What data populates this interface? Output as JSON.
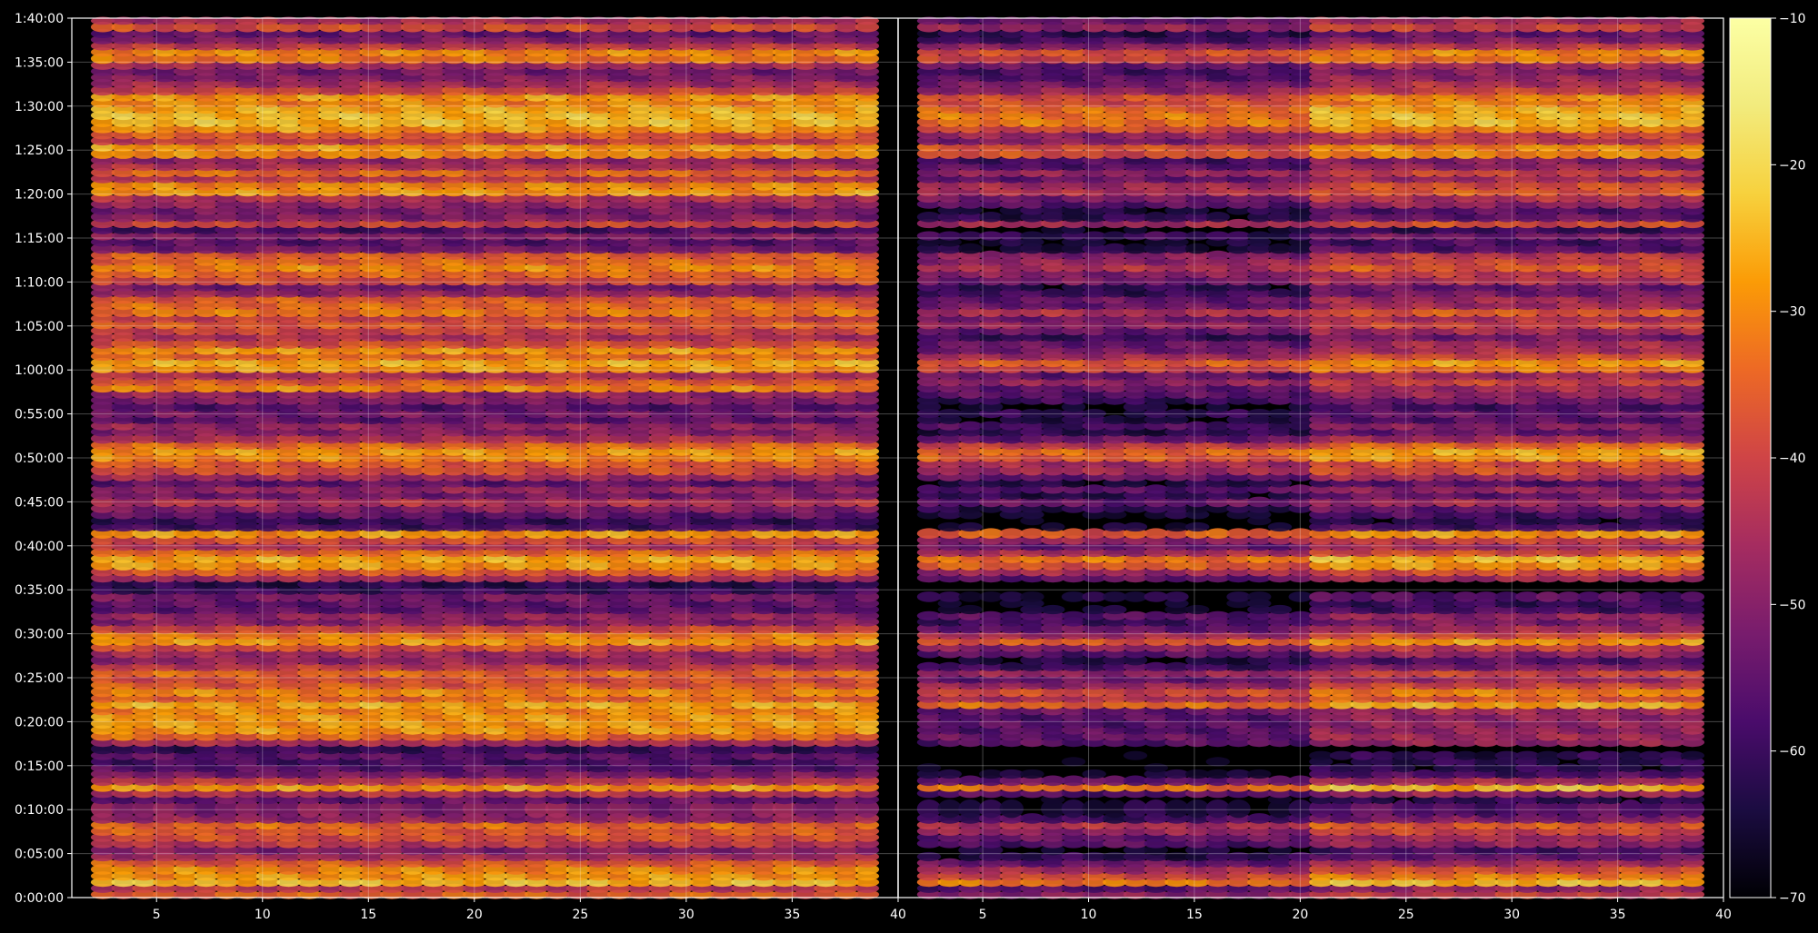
{
  "chart_data": {
    "type": "heatmap",
    "title": "",
    "xlabel": "",
    "ylabel": "",
    "panels": [
      {
        "name": "",
        "x_range": [
          1,
          40
        ]
      },
      {
        "name": "",
        "x_range": [
          40,
          80
        ]
      }
    ],
    "x_tick_labels": [
      "5",
      "10",
      "15",
      "20",
      "25",
      "30",
      "35",
      "40",
      "5",
      "10",
      "15",
      "20",
      "25",
      "30",
      "35",
      "40"
    ],
    "y_range_seconds": [
      0,
      6000
    ],
    "y_tick_labels": [
      "0:00:00",
      "0:05:00",
      "0:10:00",
      "0:15:00",
      "0:20:00",
      "0:25:00",
      "0:30:00",
      "0:35:00",
      "0:40:00",
      "0:45:00",
      "0:50:00",
      "0:55:00",
      "1:00:00",
      "1:05:00",
      "1:10:00",
      "1:15:00",
      "1:20:00",
      "1:25:00",
      "1:30:00",
      "1:35:00",
      "1:40:00"
    ],
    "colorbar": {
      "colormap": "inferno",
      "range": [
        -70,
        -10
      ],
      "tick_labels": [
        "−10",
        "−20",
        "−30",
        "−40",
        "−50",
        "−60",
        "−70"
      ]
    },
    "grid": true,
    "band_levels_description": "approximate level (dB) per horizontal band: [time_min, level_left_panel, level_right_panel]",
    "bands": [
      [
        0.0,
        -35,
        -45
      ],
      [
        0.7,
        -42,
        -52
      ],
      [
        1.4,
        -24,
        -28
      ],
      [
        2.1,
        -28,
        -35
      ],
      [
        2.8,
        -30,
        -42
      ],
      [
        3.6,
        -36,
        -50
      ],
      [
        4.3,
        -45,
        -58
      ],
      [
        5.0,
        -50,
        -62
      ],
      [
        5.8,
        -42,
        -52
      ],
      [
        6.5,
        -38,
        -50
      ],
      [
        7.2,
        -36,
        -44
      ],
      [
        7.9,
        -34,
        -40
      ],
      [
        8.6,
        -48,
        -55
      ],
      [
        9.4,
        -50,
        -60
      ],
      [
        10.8,
        -55,
        -66
      ],
      [
        11.5,
        -44,
        -52
      ],
      [
        12.2,
        -28,
        -28
      ],
      [
        12.9,
        -42,
        -50
      ],
      [
        13.7,
        -52,
        -62
      ],
      [
        14.4,
        -56,
        -66
      ],
      [
        15.1,
        -58,
        -66
      ],
      [
        15.8,
        -55,
        -66
      ],
      [
        16.5,
        -60,
        -68
      ],
      [
        17.3,
        -45,
        -52
      ],
      [
        18.0,
        -34,
        -50
      ],
      [
        18.7,
        -28,
        -52
      ],
      [
        19.4,
        -28,
        -52
      ],
      [
        20.2,
        -28,
        -52
      ],
      [
        20.9,
        -30,
        -50
      ],
      [
        21.6,
        -26,
        -30
      ],
      [
        22.3,
        -34,
        -40
      ],
      [
        23.0,
        -30,
        -35
      ],
      [
        23.8,
        -36,
        -44
      ],
      [
        24.5,
        -38,
        -50
      ],
      [
        25.2,
        -34,
        -44
      ],
      [
        25.9,
        -42,
        -55
      ],
      [
        26.6,
        -48,
        -60
      ],
      [
        27.4,
        -46,
        -52
      ],
      [
        28.1,
        -38,
        -45
      ],
      [
        28.8,
        -28,
        -32
      ],
      [
        29.5,
        -32,
        -42
      ],
      [
        30.2,
        -40,
        -50
      ],
      [
        31.0,
        -50,
        -55
      ],
      [
        31.7,
        -48,
        -52
      ],
      [
        32.4,
        -55,
        -62
      ],
      [
        33.1,
        -55,
        -64
      ],
      [
        33.8,
        -52,
        -60
      ],
      [
        34.6,
        -60,
        -68
      ],
      [
        35.3,
        -62,
        -68
      ],
      [
        36.0,
        -45,
        -50
      ],
      [
        36.7,
        -36,
        -42
      ],
      [
        37.4,
        -28,
        -32
      ],
      [
        38.2,
        -26,
        -28
      ],
      [
        38.9,
        -34,
        -42
      ],
      [
        39.6,
        -44,
        -50
      ],
      [
        40.3,
        -38,
        -44
      ],
      [
        41.0,
        -28,
        -32
      ],
      [
        41.8,
        -58,
        -62
      ],
      [
        42.5,
        -60,
        -66
      ],
      [
        43.2,
        -55,
        -62
      ],
      [
        43.9,
        -50,
        -58
      ],
      [
        44.6,
        -44,
        -50
      ],
      [
        45.4,
        -52,
        -58
      ],
      [
        46.1,
        -48,
        -52
      ],
      [
        46.8,
        -55,
        -60
      ],
      [
        47.5,
        -46,
        -50
      ],
      [
        48.2,
        -38,
        -42
      ],
      [
        49.0,
        -36,
        -42
      ],
      [
        49.7,
        -30,
        -32
      ],
      [
        50.4,
        -28,
        -30
      ],
      [
        51.1,
        -34,
        -38
      ],
      [
        51.8,
        -44,
        -50
      ],
      [
        52.6,
        -50,
        -58
      ],
      [
        53.3,
        -48,
        -54
      ],
      [
        54.0,
        -55,
        -60
      ],
      [
        54.7,
        -52,
        -58
      ],
      [
        55.4,
        -56,
        -62
      ],
      [
        56.2,
        -50,
        -56
      ],
      [
        56.9,
        -48,
        -52
      ],
      [
        57.6,
        -30,
        -50
      ],
      [
        58.3,
        -36,
        -44
      ],
      [
        59.0,
        -44,
        -50
      ],
      [
        59.8,
        -28,
        -36
      ],
      [
        60.5,
        -26,
        -32
      ],
      [
        61.2,
        -34,
        -42
      ],
      [
        61.9,
        -28,
        -48
      ],
      [
        62.6,
        -38,
        -50
      ],
      [
        63.4,
        -44,
        -56
      ],
      [
        64.1,
        -40,
        -50
      ],
      [
        64.8,
        -36,
        -44
      ],
      [
        65.5,
        -40,
        -48
      ],
      [
        66.2,
        -32,
        -40
      ],
      [
        67.0,
        -34,
        -50
      ],
      [
        67.7,
        -36,
        -50
      ],
      [
        68.4,
        -48,
        -56
      ],
      [
        69.1,
        -52,
        -58
      ],
      [
        69.8,
        -38,
        -48
      ],
      [
        70.6,
        -34,
        -46
      ],
      [
        71.3,
        -30,
        -40
      ],
      [
        72.0,
        -34,
        -44
      ],
      [
        72.7,
        -36,
        -46
      ],
      [
        73.4,
        -52,
        -60
      ],
      [
        74.2,
        -56,
        -62
      ],
      [
        74.9,
        -50,
        -56
      ],
      [
        75.6,
        -58,
        -64
      ],
      [
        76.3,
        -40,
        -42
      ],
      [
        77.0,
        -50,
        -58
      ],
      [
        77.8,
        -52,
        -60
      ],
      [
        78.5,
        -48,
        -52
      ],
      [
        79.2,
        -44,
        -48
      ],
      [
        79.9,
        -28,
        -40
      ],
      [
        80.6,
        -30,
        -42
      ],
      [
        81.4,
        -42,
        -50
      ],
      [
        82.1,
        -34,
        -44
      ],
      [
        82.8,
        -44,
        -52
      ],
      [
        83.5,
        -48,
        -54
      ],
      [
        84.2,
        -30,
        -34
      ],
      [
        85.0,
        -28,
        -34
      ],
      [
        85.7,
        -40,
        -46
      ],
      [
        86.4,
        -36,
        -44
      ],
      [
        87.1,
        -28,
        -34
      ],
      [
        87.8,
        -24,
        -28
      ],
      [
        88.6,
        -24,
        -28
      ],
      [
        89.3,
        -26,
        -30
      ],
      [
        90.0,
        -30,
        -34
      ],
      [
        90.7,
        -28,
        -34
      ],
      [
        91.4,
        -40,
        -44
      ],
      [
        92.2,
        -46,
        -48
      ],
      [
        92.9,
        -50,
        -52
      ],
      [
        93.6,
        -52,
        -54
      ],
      [
        94.3,
        -46,
        -50
      ],
      [
        95.0,
        -32,
        -36
      ],
      [
        95.8,
        -30,
        -34
      ],
      [
        96.5,
        -42,
        -46
      ],
      [
        97.2,
        -50,
        -54
      ],
      [
        97.9,
        -54,
        -58
      ],
      [
        98.6,
        -38,
        -44
      ],
      [
        99.4,
        -45,
        -50
      ]
    ]
  }
}
